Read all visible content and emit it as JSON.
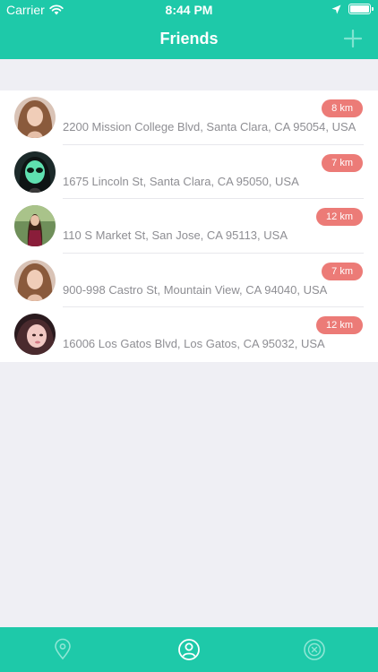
{
  "status_bar": {
    "carrier": "Carrier",
    "time": "8:44 PM"
  },
  "nav": {
    "title": "Friends",
    "add_icon": "plus-icon"
  },
  "colors": {
    "accent": "#1ec9a9",
    "badge": "#ec7b77",
    "background": "#efeff4"
  },
  "friends": [
    {
      "address": "2200 Mission College Blvd, Santa Clara, CA 95054, USA",
      "distance": "8 km",
      "avatar": "woman-portrait"
    },
    {
      "address": "1675 Lincoln St, Santa Clara, CA 95050, USA",
      "distance": "7 km",
      "avatar": "alien-portrait"
    },
    {
      "address": "110 S Market St, San Jose, CA 95113, USA",
      "distance": "12 km",
      "avatar": "woman-outdoor-portrait"
    },
    {
      "address": "900-998 Castro St, Mountain View, CA 94040, USA",
      "distance": "7 km",
      "avatar": "woman-portrait"
    },
    {
      "address": "16006 Los Gatos Blvd, Los Gatos, CA 95032, USA",
      "distance": "12 km",
      "avatar": "woman-closeup-portrait"
    }
  ],
  "tabs": [
    {
      "icon": "map-pin-icon",
      "active": false
    },
    {
      "icon": "profile-icon",
      "active": true
    },
    {
      "icon": "close-circle-icon",
      "active": false
    }
  ]
}
